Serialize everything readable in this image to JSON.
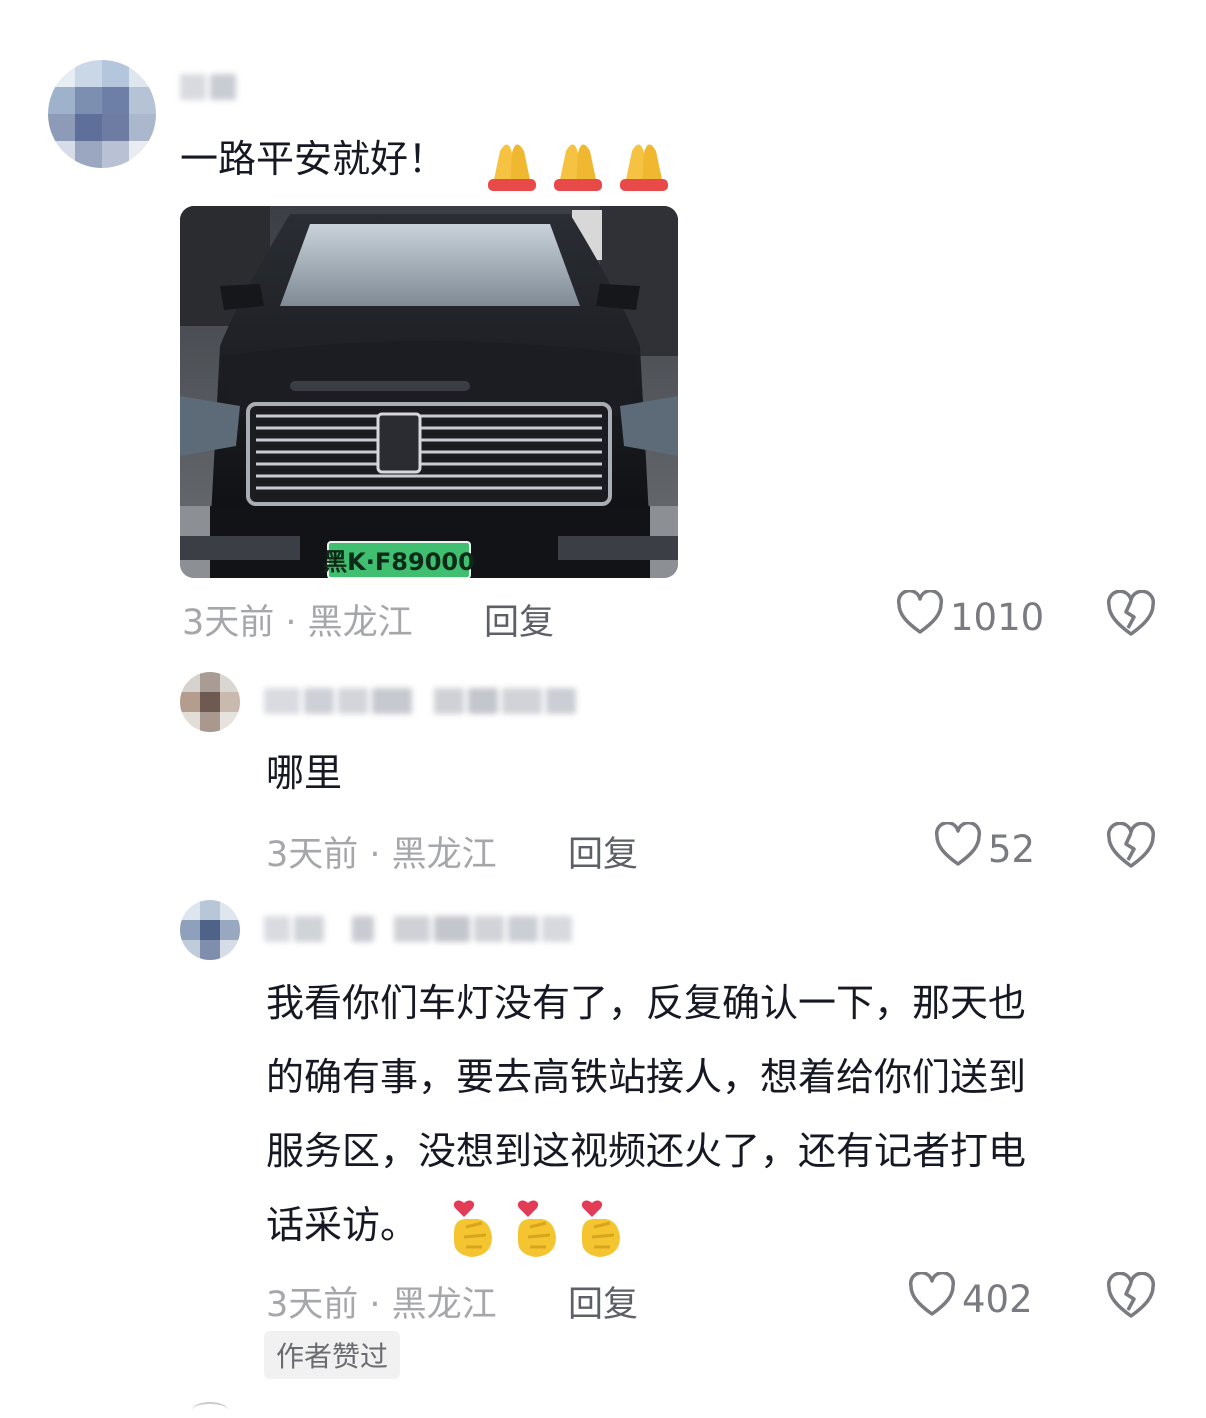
{
  "comments": [
    {
      "text": "一路平安就好！",
      "emoji_icon": "praying-hands-icon",
      "time_location": "3天前 · 黑龙江",
      "reply_label": "回复",
      "likes": "1010",
      "photo": {
        "plate": "黑K·F89000"
      }
    },
    {
      "text": "哪里",
      "time_location": "3天前 · 黑龙江",
      "reply_label": "回复",
      "likes": "52"
    },
    {
      "text_lines": [
        "我看你们车灯没有了，反复确认一下，那天也",
        "的确有事，要去高铁站接人，想着给你们送到",
        "服务区，没想到这视频还火了，还有记者打电",
        "话采访。"
      ],
      "emoji_icon": "finger-heart-icon",
      "time_location": "3天前 · 黑龙江",
      "reply_label": "回复",
      "likes": "402",
      "badge": "作者赞过"
    }
  ],
  "colors": {
    "text": "#161823",
    "meta": "#a6a7ab",
    "reply": "#5e6068",
    "badge_bg": "#f1f1f2"
  }
}
